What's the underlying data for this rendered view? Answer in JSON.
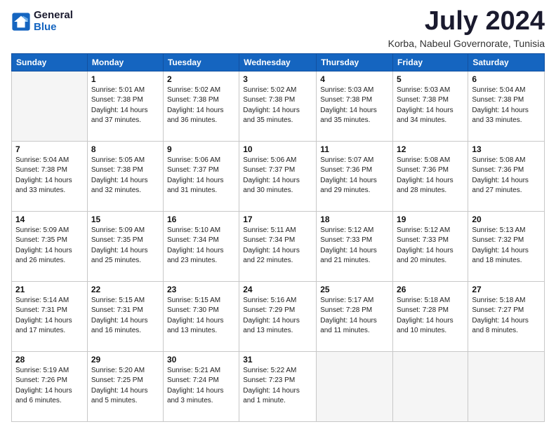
{
  "header": {
    "logo": {
      "general": "General",
      "blue": "Blue"
    },
    "title": "July 2024",
    "subtitle": "Korba, Nabeul Governorate, Tunisia"
  },
  "calendar": {
    "days_of_week": [
      "Sunday",
      "Monday",
      "Tuesday",
      "Wednesday",
      "Thursday",
      "Friday",
      "Saturday"
    ],
    "weeks": [
      [
        {
          "day": "",
          "sunrise": "",
          "sunset": "",
          "daylight": ""
        },
        {
          "day": "1",
          "sunrise": "Sunrise: 5:01 AM",
          "sunset": "Sunset: 7:38 PM",
          "daylight": "Daylight: 14 hours and 37 minutes."
        },
        {
          "day": "2",
          "sunrise": "Sunrise: 5:02 AM",
          "sunset": "Sunset: 7:38 PM",
          "daylight": "Daylight: 14 hours and 36 minutes."
        },
        {
          "day": "3",
          "sunrise": "Sunrise: 5:02 AM",
          "sunset": "Sunset: 7:38 PM",
          "daylight": "Daylight: 14 hours and 35 minutes."
        },
        {
          "day": "4",
          "sunrise": "Sunrise: 5:03 AM",
          "sunset": "Sunset: 7:38 PM",
          "daylight": "Daylight: 14 hours and 35 minutes."
        },
        {
          "day": "5",
          "sunrise": "Sunrise: 5:03 AM",
          "sunset": "Sunset: 7:38 PM",
          "daylight": "Daylight: 14 hours and 34 minutes."
        },
        {
          "day": "6",
          "sunrise": "Sunrise: 5:04 AM",
          "sunset": "Sunset: 7:38 PM",
          "daylight": "Daylight: 14 hours and 33 minutes."
        }
      ],
      [
        {
          "day": "7",
          "sunrise": "Sunrise: 5:04 AM",
          "sunset": "Sunset: 7:38 PM",
          "daylight": "Daylight: 14 hours and 33 minutes."
        },
        {
          "day": "8",
          "sunrise": "Sunrise: 5:05 AM",
          "sunset": "Sunset: 7:38 PM",
          "daylight": "Daylight: 14 hours and 32 minutes."
        },
        {
          "day": "9",
          "sunrise": "Sunrise: 5:06 AM",
          "sunset": "Sunset: 7:37 PM",
          "daylight": "Daylight: 14 hours and 31 minutes."
        },
        {
          "day": "10",
          "sunrise": "Sunrise: 5:06 AM",
          "sunset": "Sunset: 7:37 PM",
          "daylight": "Daylight: 14 hours and 30 minutes."
        },
        {
          "day": "11",
          "sunrise": "Sunrise: 5:07 AM",
          "sunset": "Sunset: 7:36 PM",
          "daylight": "Daylight: 14 hours and 29 minutes."
        },
        {
          "day": "12",
          "sunrise": "Sunrise: 5:08 AM",
          "sunset": "Sunset: 7:36 PM",
          "daylight": "Daylight: 14 hours and 28 minutes."
        },
        {
          "day": "13",
          "sunrise": "Sunrise: 5:08 AM",
          "sunset": "Sunset: 7:36 PM",
          "daylight": "Daylight: 14 hours and 27 minutes."
        }
      ],
      [
        {
          "day": "14",
          "sunrise": "Sunrise: 5:09 AM",
          "sunset": "Sunset: 7:35 PM",
          "daylight": "Daylight: 14 hours and 26 minutes."
        },
        {
          "day": "15",
          "sunrise": "Sunrise: 5:09 AM",
          "sunset": "Sunset: 7:35 PM",
          "daylight": "Daylight: 14 hours and 25 minutes."
        },
        {
          "day": "16",
          "sunrise": "Sunrise: 5:10 AM",
          "sunset": "Sunset: 7:34 PM",
          "daylight": "Daylight: 14 hours and 23 minutes."
        },
        {
          "day": "17",
          "sunrise": "Sunrise: 5:11 AM",
          "sunset": "Sunset: 7:34 PM",
          "daylight": "Daylight: 14 hours and 22 minutes."
        },
        {
          "day": "18",
          "sunrise": "Sunrise: 5:12 AM",
          "sunset": "Sunset: 7:33 PM",
          "daylight": "Daylight: 14 hours and 21 minutes."
        },
        {
          "day": "19",
          "sunrise": "Sunrise: 5:12 AM",
          "sunset": "Sunset: 7:33 PM",
          "daylight": "Daylight: 14 hours and 20 minutes."
        },
        {
          "day": "20",
          "sunrise": "Sunrise: 5:13 AM",
          "sunset": "Sunset: 7:32 PM",
          "daylight": "Daylight: 14 hours and 18 minutes."
        }
      ],
      [
        {
          "day": "21",
          "sunrise": "Sunrise: 5:14 AM",
          "sunset": "Sunset: 7:31 PM",
          "daylight": "Daylight: 14 hours and 17 minutes."
        },
        {
          "day": "22",
          "sunrise": "Sunrise: 5:15 AM",
          "sunset": "Sunset: 7:31 PM",
          "daylight": "Daylight: 14 hours and 16 minutes."
        },
        {
          "day": "23",
          "sunrise": "Sunrise: 5:15 AM",
          "sunset": "Sunset: 7:30 PM",
          "daylight": "Daylight: 14 hours and 13 minutes."
        },
        {
          "day": "24",
          "sunrise": "Sunrise: 5:16 AM",
          "sunset": "Sunset: 7:29 PM",
          "daylight": "Daylight: 14 hours and 13 minutes."
        },
        {
          "day": "25",
          "sunrise": "Sunrise: 5:17 AM",
          "sunset": "Sunset: 7:28 PM",
          "daylight": "Daylight: 14 hours and 11 minutes."
        },
        {
          "day": "26",
          "sunrise": "Sunrise: 5:18 AM",
          "sunset": "Sunset: 7:28 PM",
          "daylight": "Daylight: 14 hours and 10 minutes."
        },
        {
          "day": "27",
          "sunrise": "Sunrise: 5:18 AM",
          "sunset": "Sunset: 7:27 PM",
          "daylight": "Daylight: 14 hours and 8 minutes."
        }
      ],
      [
        {
          "day": "28",
          "sunrise": "Sunrise: 5:19 AM",
          "sunset": "Sunset: 7:26 PM",
          "daylight": "Daylight: 14 hours and 6 minutes."
        },
        {
          "day": "29",
          "sunrise": "Sunrise: 5:20 AM",
          "sunset": "Sunset: 7:25 PM",
          "daylight": "Daylight: 14 hours and 5 minutes."
        },
        {
          "day": "30",
          "sunrise": "Sunrise: 5:21 AM",
          "sunset": "Sunset: 7:24 PM",
          "daylight": "Daylight: 14 hours and 3 minutes."
        },
        {
          "day": "31",
          "sunrise": "Sunrise: 5:22 AM",
          "sunset": "Sunset: 7:23 PM",
          "daylight": "Daylight: 14 hours and 1 minute."
        },
        {
          "day": "",
          "sunrise": "",
          "sunset": "",
          "daylight": ""
        },
        {
          "day": "",
          "sunrise": "",
          "sunset": "",
          "daylight": ""
        },
        {
          "day": "",
          "sunrise": "",
          "sunset": "",
          "daylight": ""
        }
      ]
    ]
  }
}
